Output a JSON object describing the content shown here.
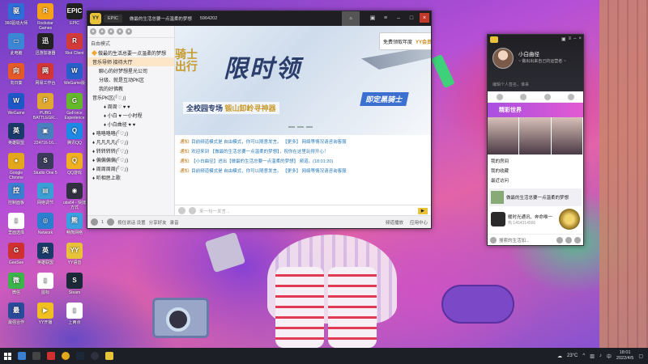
{
  "desktop_icons": [
    {
      "label": "360驱动大师",
      "color": "#2d6fd6",
      "glyph": "驱"
    },
    {
      "label": "Rockstar Games",
      "color": "#f4a21a",
      "glyph": "R"
    },
    {
      "label": "EPIC",
      "color": "#222222",
      "glyph": "EPIC"
    },
    {
      "label": "此电脑",
      "color": "#3b87d6",
      "glyph": "▭"
    },
    {
      "label": "迅游加速器",
      "color": "#222222",
      "glyph": "迅"
    },
    {
      "label": "Riot Client",
      "color": "#d33a3a",
      "glyph": "R"
    },
    {
      "label": "向日葵",
      "color": "#e65a28",
      "glyph": "向"
    },
    {
      "label": "网易工作台",
      "color": "#d23636",
      "glyph": "网"
    },
    {
      "label": "WeGame版",
      "color": "#2860c9",
      "glyph": "W"
    },
    {
      "label": "WeGame",
      "color": "#1e58c7",
      "glyph": "W"
    },
    {
      "label": "PUBG BATTLEGR...",
      "color": "#e0a82e",
      "glyph": "P"
    },
    {
      "label": "GeForce Experience",
      "color": "#64b92a",
      "glyph": "G"
    },
    {
      "label": "英雄联盟",
      "color": "#1a3a6a",
      "glyph": "英"
    },
    {
      "label": "224716-16...",
      "color": "#4a7fbe",
      "glyph": "▣"
    },
    {
      "label": "腾讯QQ",
      "color": "#1e88e5",
      "glyph": "Q"
    },
    {
      "label": "Google Chrome",
      "color": "#e3a71c",
      "glyph": "●"
    },
    {
      "label": "Studio One 5",
      "color": "#3a3a5a",
      "glyph": "S"
    },
    {
      "label": "QQ游戏",
      "color": "#f0b020",
      "glyph": "Q"
    },
    {
      "label": "控制面板",
      "color": "#3a7fd0",
      "glyph": "控"
    },
    {
      "label": "网络调节",
      "color": "#3b9fd6",
      "glyph": "▤"
    },
    {
      "label": "obs64 - 快捷方式",
      "color": "#303040",
      "glyph": "◉"
    },
    {
      "label": "里面选择",
      "color": "#ffffff",
      "glyph": "▯"
    },
    {
      "label": "Network",
      "color": "#2a7fcf",
      "glyph": "◎"
    },
    {
      "label": "畅熊网络",
      "color": "#3aa0e0",
      "glyph": "熊"
    },
    {
      "label": "GeeSee",
      "color": "#d03030",
      "glyph": "G"
    },
    {
      "label": "英雄联盟",
      "color": "#1a3a6a",
      "glyph": "英"
    },
    {
      "label": "YY语音",
      "color": "#e8c33a",
      "glyph": "YY"
    },
    {
      "label": "微信",
      "color": "#3bb54a",
      "glyph": "微"
    },
    {
      "label": "图标",
      "color": "#ffffff",
      "glyph": "▯"
    },
    {
      "label": "Steam",
      "color": "#1b2838",
      "glyph": "S"
    },
    {
      "label": "最强合作",
      "color": "#2a4a9a",
      "glyph": "最"
    },
    {
      "label": "YY开播",
      "color": "#f0c020",
      "glyph": "▶"
    },
    {
      "label": "上两点",
      "color": "#ffffff",
      "glyph": "▯"
    }
  ],
  "main_window": {
    "logo": "YY",
    "tab": "EPIC",
    "channel_name": "做最的生活总要一点温柔的梦想",
    "channel_id": "5964202",
    "sidebar": {
      "mode": "自由模式",
      "rows": [
        {
          "text": "做最的生活总要一点温柔的梦想",
          "cls": "",
          "gem": true
        },
        {
          "text": "音乐导师 接待大厅",
          "cls": "sel",
          "gem": false
        },
        {
          "text": "聊心的好梦想星光公司",
          "cls": "sub",
          "gem": false
        },
        {
          "text": "分级、就是互动PK区",
          "cls": "sub",
          "gem": false
        },
        {
          "text": "我的好佛教",
          "cls": "sub",
          "gem": false
        },
        {
          "text": "音乐PK区(「♡」)",
          "cls": "",
          "gem": false
        },
        {
          "text": "♦ 周周♡ ♥ ♥",
          "cls": "sub2",
          "gem": false
        },
        {
          "text": "♦ 小白 ♥ 一小时程",
          "cls": "sub2",
          "gem": false
        },
        {
          "text": "♦ 小白曲径 ♥ ♥",
          "cls": "sub2",
          "gem": false
        },
        {
          "text": "♦ 咯咯咯咯(「♡」)",
          "cls": "",
          "gem": false
        },
        {
          "text": "♦ 凡凡凡凡(「♡」)",
          "cls": "",
          "gem": false
        },
        {
          "text": "♦ 转转转转(「♡」)",
          "cls": "",
          "gem": false
        },
        {
          "text": "♦ 偏偏偏偏(「♡」)",
          "cls": "",
          "gem": false
        },
        {
          "text": "♦ 周周周周(「♡」)",
          "cls": "",
          "gem": false
        },
        {
          "text": "♦ 听相思上歌",
          "cls": "",
          "gem": false
        }
      ]
    },
    "banner": {
      "left_text": "骑士\n出行",
      "headline": "限时领",
      "subline_a": "全校园专场 ",
      "subline_b": "锻山卸岭寻神器",
      "knight": "即定黑骑士",
      "vip_label": "免费领取年度",
      "vip_gold": "YY会员"
    },
    "chat": [
      {
        "tag": "通知:",
        "text": "目前频道模式是 自由模式，你可以随意发言。 【更多】 网络等情况请咨询客服"
      },
      {
        "tag": "通知:",
        "text": "欢迎来到 【做最的生活总要一点温柔的梦想】，祝你在这里玩得开心！"
      },
      {
        "tag": "通知:",
        "text": "【小白曲径】进出【做最的生活总要一点温柔的梦想】 频道。(18:01:20)"
      },
      {
        "tag": "通知:",
        "text": "目前频道模式是 自由模式，你可以随意发言。 【更多】 网络等情况请咨询客服"
      }
    ],
    "input_placeholder": "来一句一发言...",
    "bottom": {
      "user_count": "1",
      "mic_label": "按住说话 设置",
      "share": "分享好友",
      "record": "录音",
      "push_a": "频道播放",
      "push_b": "应用中心"
    }
  },
  "side_window": {
    "logo": "YY",
    "nickname": "小白曲径",
    "signature": "~ 做出出来自己的运营者 ~",
    "more": "编辑个人签名，谁来",
    "promo_title": "精彩世界",
    "list": [
      "我的房间",
      "我的收藏",
      "最近访问"
    ],
    "recent": "做最的生活总要一点温柔的梦想",
    "ad_title": "暖时光通讯、奔命唯一",
    "ad_sub": "热 1454314566",
    "foot": "搜索的生活加..."
  },
  "taskbar": {
    "temp": "23°C",
    "time": "18:01",
    "date": "2022/4/5",
    "ime": "中"
  }
}
